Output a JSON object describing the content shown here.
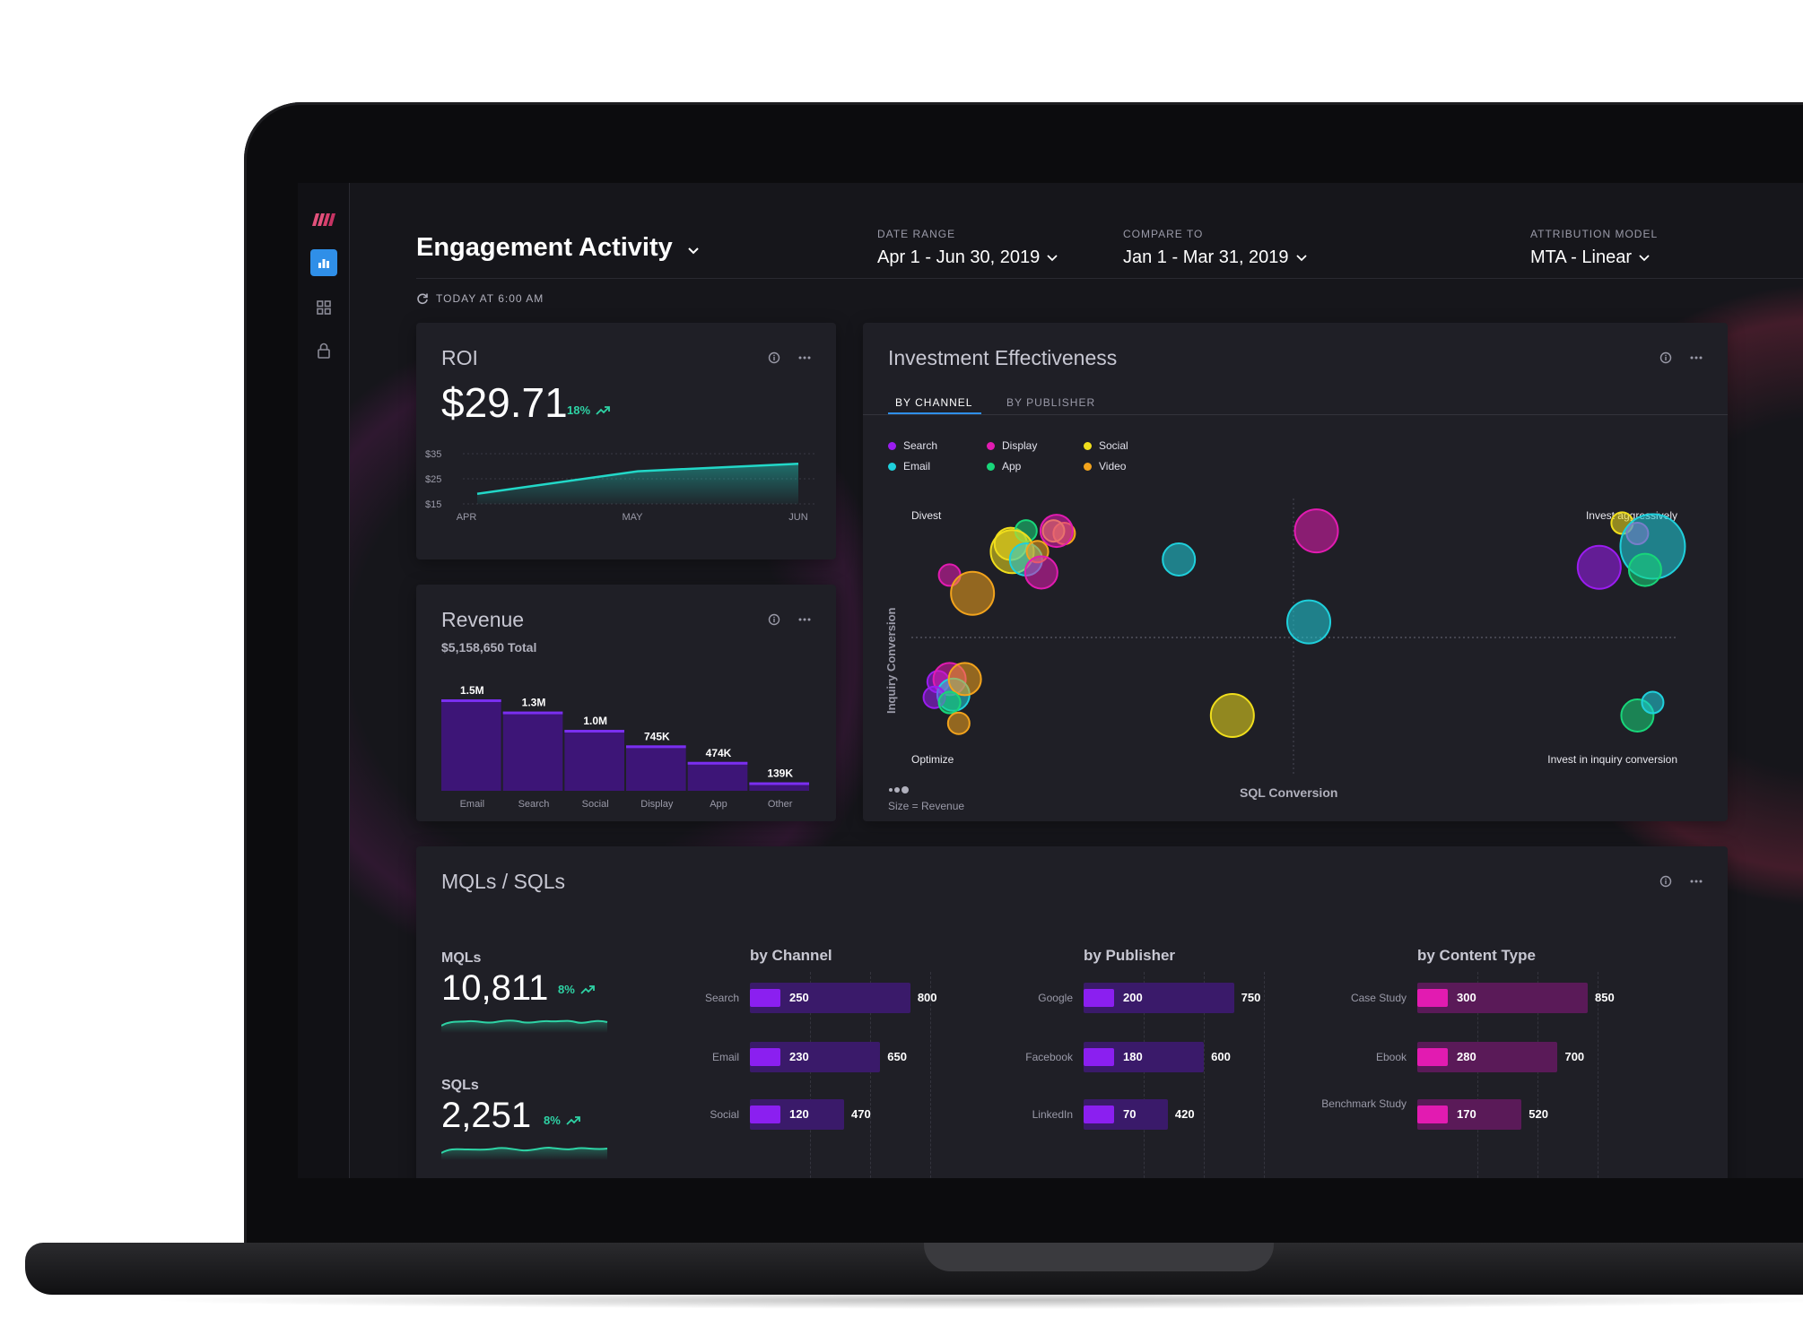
{
  "header": {
    "title": "Engagement Activity",
    "date_range": {
      "label": "DATE RANGE",
      "value": "Apr 1 - Jun 30, 2019"
    },
    "compare_to": {
      "label": "COMPARE TO",
      "value": "Jan 1 - Mar 31, 2019"
    },
    "attribution": {
      "label": "ATTRIBUTION MODEL",
      "value": "MTA - Linear"
    },
    "refresh_text": "TODAY AT 6:00 AM"
  },
  "sidebar": {
    "items": [
      {
        "icon": "logo-icon"
      },
      {
        "icon": "bar-chart-icon",
        "active": true
      },
      {
        "icon": "grid-icon"
      },
      {
        "icon": "lock-icon"
      }
    ]
  },
  "colors": {
    "Search": "#9b1cf0",
    "Email": "#1fd0dc",
    "Display": "#e21bb1",
    "App": "#18d67a",
    "Social": "#f0de1c",
    "Video": "#f2a31c",
    "accent_green": "#2ed3a5",
    "bar_purple": "#5a17a8"
  },
  "roi": {
    "title": "ROI",
    "value": "$29.71",
    "delta": "18%",
    "chart_data": {
      "type": "area",
      "x": [
        "APR",
        "MAY",
        "JUN"
      ],
      "y_ticks": [
        "$35",
        "$25",
        "$15"
      ],
      "ylim": [
        15,
        35
      ],
      "points": [
        {
          "x": 0.0,
          "y": 19
        },
        {
          "x": 1.0,
          "y": 28
        },
        {
          "x": 2.0,
          "y": 31
        }
      ]
    }
  },
  "revenue": {
    "title": "Revenue",
    "total": "$5,158,650 Total",
    "chart_data": {
      "type": "bar",
      "categories": [
        "Email",
        "Search",
        "Social",
        "Display",
        "App",
        "Other"
      ],
      "values": [
        1500000,
        1300000,
        1000000,
        745000,
        474000,
        139000
      ],
      "labels": [
        "1.5M",
        "1.3M",
        "1.0M",
        "745K",
        "474K",
        "139K"
      ],
      "ylim": [
        0,
        1500000
      ]
    }
  },
  "investment": {
    "title": "Investment Effectiveness",
    "tabs": [
      "BY CHANNEL",
      "BY PUBLISHER"
    ],
    "active_tab": 0,
    "legend": [
      "Search",
      "Display",
      "Social",
      "Email",
      "App",
      "Video"
    ],
    "quadrants": {
      "top_left": "Divest",
      "top_right": "Invest aggressively",
      "bottom_left": "Optimize",
      "bottom_right": "Invest in inquiry conversion"
    },
    "x_axis_label": "SQL Conversion",
    "y_axis_label": "Inquiry Conversion",
    "size_note": "Size = Revenue",
    "chart_data": {
      "type": "scatter",
      "xlabel": "SQL Conversion",
      "ylabel": "Inquiry Conversion",
      "xlim": [
        0,
        100
      ],
      "ylim": [
        0,
        100
      ],
      "points": [
        {
          "series": "Social",
          "x": 13.0,
          "y": 86,
          "r": 2
        },
        {
          "series": "App",
          "x": 15.0,
          "y": 91,
          "r": 1
        },
        {
          "series": "Social",
          "x": 13.2,
          "y": 83,
          "r": 3
        },
        {
          "series": "Email",
          "x": 15.0,
          "y": 80,
          "r": 2
        },
        {
          "series": "Video",
          "x": 20.0,
          "y": 90,
          "r": 1
        },
        {
          "series": "Social",
          "x": 18.6,
          "y": 91,
          "r": 1
        },
        {
          "series": "Display",
          "x": 19.0,
          "y": 91,
          "r": 2
        },
        {
          "series": "Video",
          "x": 16.5,
          "y": 83,
          "r": 1
        },
        {
          "series": "Display",
          "x": 5.0,
          "y": 74,
          "r": 1
        },
        {
          "series": "Display",
          "x": 17.0,
          "y": 75,
          "r": 2
        },
        {
          "series": "Video",
          "x": 8.0,
          "y": 67,
          "r": 3
        },
        {
          "series": "Email",
          "x": 35.0,
          "y": 80,
          "r": 2
        },
        {
          "series": "Display",
          "x": 53.0,
          "y": 91,
          "r": 3
        },
        {
          "series": "Email",
          "x": 52.0,
          "y": 56,
          "r": 3
        },
        {
          "series": "Social",
          "x": 42.0,
          "y": 20,
          "r": 3
        },
        {
          "series": "Search",
          "x": 3.5,
          "y": 33,
          "r": 1
        },
        {
          "series": "Display",
          "x": 5.0,
          "y": 34,
          "r": 2
        },
        {
          "series": "Email",
          "x": 5.5,
          "y": 28,
          "r": 2
        },
        {
          "series": "Video",
          "x": 7.0,
          "y": 34,
          "r": 2
        },
        {
          "series": "Search",
          "x": 3.0,
          "y": 27,
          "r": 1
        },
        {
          "series": "App",
          "x": 5.0,
          "y": 25,
          "r": 1
        },
        {
          "series": "Video",
          "x": 6.2,
          "y": 17,
          "r": 1
        },
        {
          "series": "Social",
          "x": 93.0,
          "y": 94,
          "r": 1
        },
        {
          "series": "Display",
          "x": 95.0,
          "y": 90,
          "r": 1
        },
        {
          "series": "Search",
          "x": 90.0,
          "y": 77,
          "r": 3
        },
        {
          "series": "Email",
          "x": 97.0,
          "y": 85,
          "r": 5
        },
        {
          "series": "App",
          "x": 96.0,
          "y": 76,
          "r": 2
        },
        {
          "series": "App",
          "x": 95.0,
          "y": 20,
          "r": 2
        },
        {
          "series": "Email",
          "x": 97.0,
          "y": 25,
          "r": 1
        }
      ]
    }
  },
  "mqls": {
    "title": "MQLs / SQLs",
    "mql": {
      "label": "MQLs",
      "value": "10,811",
      "delta": "8%"
    },
    "sql": {
      "label": "SQLs",
      "value": "2,251",
      "delta": "8%"
    },
    "groups": [
      {
        "title": "by Channel",
        "rows": [
          {
            "label": "Search",
            "inner": "250",
            "outer": "800",
            "inner_val": 250,
            "outer_val": 800
          },
          {
            "label": "Email",
            "inner": "230",
            "outer": "650",
            "inner_val": 230,
            "outer_val": 650
          },
          {
            "label": "Social",
            "inner": "120",
            "outer": "470",
            "inner_val": 120,
            "outer_val": 470
          }
        ]
      },
      {
        "title": "by Publisher",
        "rows": [
          {
            "label": "Google",
            "inner": "200",
            "outer": "750",
            "inner_val": 200,
            "outer_val": 750
          },
          {
            "label": "Facebook",
            "inner": "180",
            "outer": "600",
            "inner_val": 180,
            "outer_val": 600
          },
          {
            "label": "LinkedIn",
            "inner": "70",
            "outer": "420",
            "inner_val": 70,
            "outer_val": 420
          }
        ]
      },
      {
        "title": "by Content Type",
        "rows": [
          {
            "label": "Case Study",
            "inner": "300",
            "outer": "850",
            "inner_val": 300,
            "outer_val": 850
          },
          {
            "label": "Ebook",
            "inner": "280",
            "outer": "700",
            "inner_val": 280,
            "outer_val": 700
          },
          {
            "label": "Benchmark Study",
            "inner": "170",
            "outer": "520",
            "inner_val": 170,
            "outer_val": 520
          }
        ]
      }
    ]
  }
}
